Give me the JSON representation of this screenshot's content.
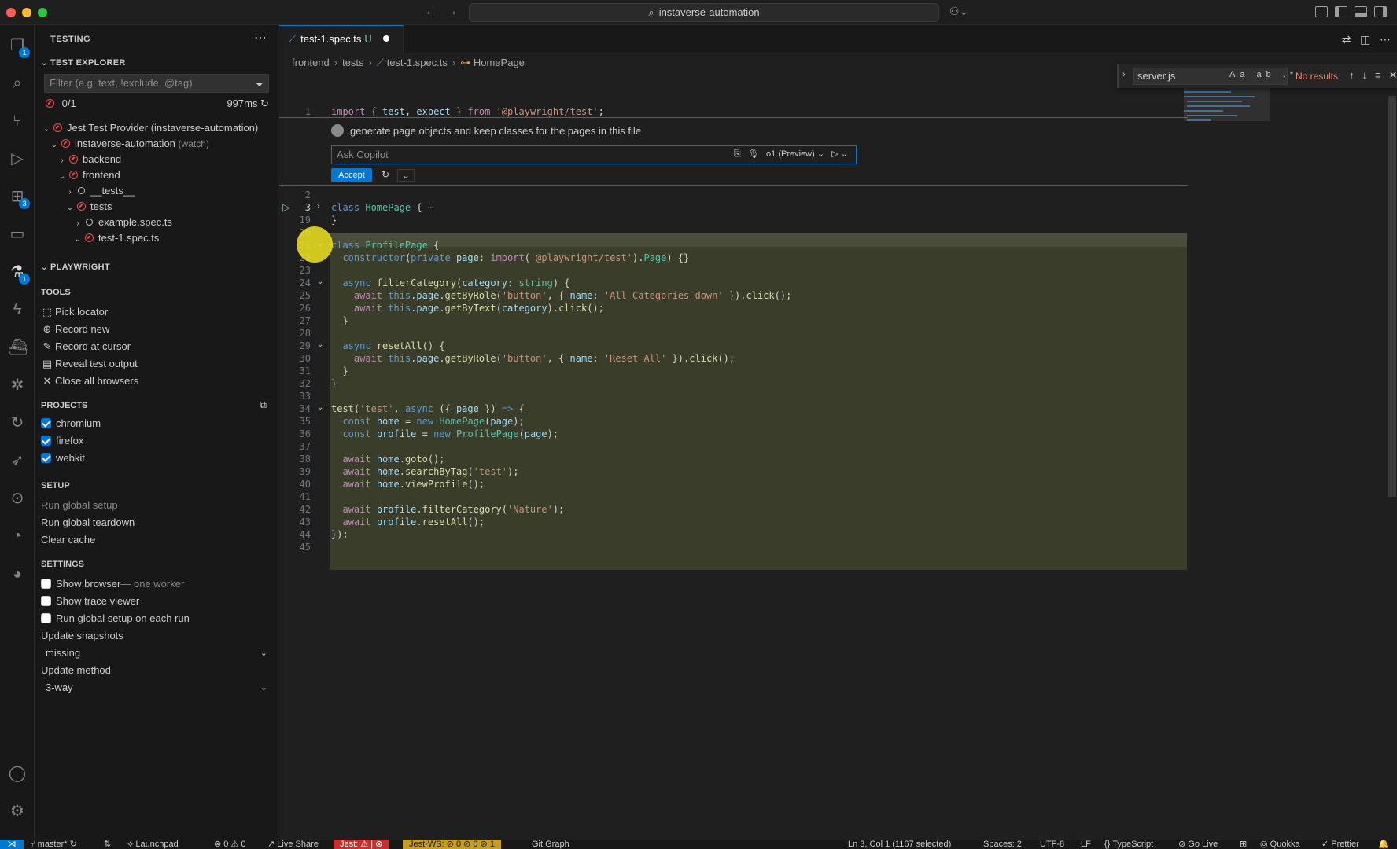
{
  "titlebar": {
    "search_text": "instaverse-automation"
  },
  "sidebar": {
    "header": "TESTING",
    "test_explorer": {
      "title": "TEST EXPLORER",
      "filter_placeholder": "Filter (e.g. text, !exclude, @tag)",
      "result_count": "0/1",
      "duration": "997ms",
      "tree": [
        {
          "label": "Jest Test Provider (instaverse-automation)",
          "status": "failed"
        },
        {
          "label": "instaverse-automation",
          "suffix": "(watch)",
          "status": "failed"
        },
        {
          "label": "backend",
          "status": "failed"
        },
        {
          "label": "frontend",
          "status": "failed"
        },
        {
          "label": "__tests__",
          "status": "pending"
        },
        {
          "label": "tests",
          "status": "failed"
        },
        {
          "label": "example.spec.ts",
          "status": "pending"
        },
        {
          "label": "test-1.spec.ts",
          "status": "failed"
        }
      ]
    },
    "playwright": {
      "title": "PLAYWRIGHT",
      "tools_label": "TOOLS",
      "tools": [
        "Pick locator",
        "Record new",
        "Record at cursor",
        "Reveal test output",
        "Close all browsers"
      ],
      "projects_label": "PROJECTS",
      "projects": [
        {
          "label": "chromium",
          "checked": true
        },
        {
          "label": "firefox",
          "checked": true
        },
        {
          "label": "webkit",
          "checked": true
        }
      ],
      "setup_label": "SETUP",
      "setup": [
        "Run global setup",
        "Run global teardown",
        "Clear cache"
      ],
      "settings_label": "SETTINGS",
      "settings": {
        "show_browser": "Show browser",
        "show_browser_note": "— one worker",
        "show_trace_viewer": "Show trace viewer",
        "run_global_setup": "Run global setup on each run",
        "update_snapshots_label": "Update snapshots",
        "update_snapshots_value": "missing",
        "update_method_label": "Update method",
        "update_method_value": "3-way"
      }
    }
  },
  "activity_badges": {
    "explorer": "1",
    "extensions": "3",
    "testing": "1"
  },
  "editor": {
    "tab_label": "test-1.spec.ts",
    "tab_status": "U",
    "breadcrumb": [
      "frontend",
      "tests",
      "test-1.spec.ts",
      "HomePage"
    ],
    "find": {
      "value": "server.js",
      "result": "No results",
      "opts": "Aa ab .*"
    },
    "copilot": {
      "prompt": "generate page objects and keep classes for the pages in this file",
      "input_placeholder": "Ask Copilot",
      "model": "o1 (Preview)",
      "accept_label": "Accept"
    },
    "line_numbers": {
      "l1": "1",
      "l2": "2",
      "l3": "3",
      "l19": "19",
      "l20": "20",
      "l21": "21",
      "l22": "22",
      "l23": "23",
      "l24": "24",
      "l25": "25",
      "l26": "26",
      "l27": "27",
      "l28": "28",
      "l29": "29",
      "l30": "30",
      "l31": "31",
      "l32": "32",
      "l33": "33",
      "l34": "34",
      "l35": "35",
      "l36": "36",
      "l37": "37",
      "l38": "38",
      "l39": "39",
      "l40": "40",
      "l41": "41",
      "l42": "42",
      "l43": "43",
      "l44": "44",
      "l45": "45"
    }
  },
  "statusbar": {
    "branch": "master*",
    "launchpad": "Launchpad",
    "problems": "⊗ 0 ⚠ 0",
    "live_share": "Live Share",
    "jest": "Jest: ⚠ | ⊗",
    "jest_ws": "Jest-WS: ⊘ 0 ⊘ 0 ⊘ 1",
    "git_graph": "Git Graph",
    "position": "Ln 3, Col 1 (1167 selected)",
    "spaces": "Spaces: 2",
    "encoding": "UTF-8",
    "eol": "LF",
    "language": "TypeScript",
    "go_live": "Go Live",
    "quokka": "Quokka",
    "prettier": "Prettier"
  },
  "colors": {
    "accent": "#0078d4",
    "error": "#f14c4c",
    "highlight": "#3a3d2a",
    "cursor": "#f0e61e"
  }
}
